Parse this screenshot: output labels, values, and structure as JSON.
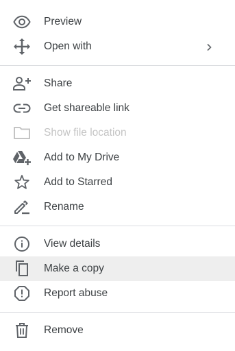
{
  "menu": {
    "items": [
      {
        "id": "preview",
        "label": "Preview",
        "icon": "eye-icon"
      },
      {
        "id": "open-with",
        "label": "Open with",
        "icon": "move-arrows-icon",
        "submenu": true
      },
      {
        "id": "share",
        "label": "Share",
        "icon": "person-add-icon"
      },
      {
        "id": "get-shareable-link",
        "label": "Get shareable link",
        "icon": "link-icon"
      },
      {
        "id": "show-file-location",
        "label": "Show file location",
        "icon": "folder-icon",
        "disabled": true
      },
      {
        "id": "add-to-my-drive",
        "label": "Add to My Drive",
        "icon": "drive-add-icon"
      },
      {
        "id": "add-to-starred",
        "label": "Add to Starred",
        "icon": "star-icon"
      },
      {
        "id": "rename",
        "label": "Rename",
        "icon": "pencil-icon"
      },
      {
        "id": "view-details",
        "label": "View details",
        "icon": "info-icon"
      },
      {
        "id": "make-a-copy",
        "label": "Make a copy",
        "icon": "copy-icon",
        "highlighted": true
      },
      {
        "id": "report-abuse",
        "label": "Report abuse",
        "icon": "report-icon"
      },
      {
        "id": "remove",
        "label": "Remove",
        "icon": "trash-icon"
      }
    ]
  },
  "colors": {
    "text": "#3c4043",
    "icon": "#5f6368",
    "disabled": "#c4c4c4",
    "hover": "#eeeeee",
    "divider": "#dadce0"
  }
}
